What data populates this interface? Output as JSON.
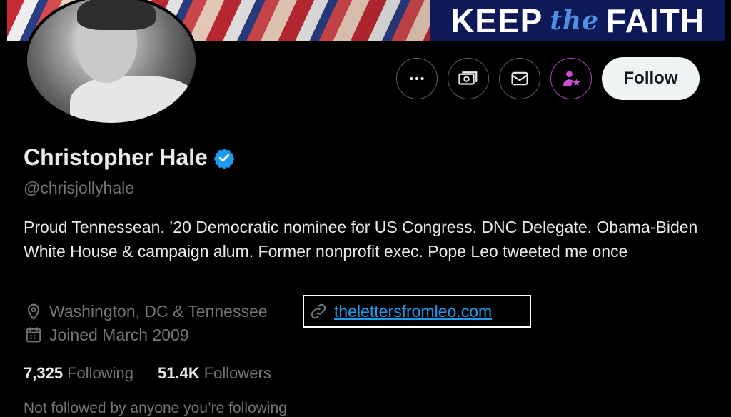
{
  "banner": {
    "sign_left": "KEEP",
    "sign_mid": "the",
    "sign_right": "FAITH"
  },
  "actions": {
    "more_icon": "more-horizontal-icon",
    "tips_icon": "money-icon",
    "message_icon": "envelope-icon",
    "subscribe_icon": "subscribe-person-star-icon",
    "follow_label": "Follow"
  },
  "profile": {
    "name": "Christopher Hale",
    "handle": "@chrisjollyhale",
    "bio": "Proud Tennessean. ’20 Democratic nominee for US Congress. DNC Delegate. Obama-Biden White House & campaign alum. Former nonprofit exec. Pope Leo tweeted me once",
    "location": "Washington, DC & Tennessee",
    "website": "thelettersfromleo.com",
    "joined": "Joined March 2009"
  },
  "stats": {
    "following_count": "7,325",
    "following_label": "Following",
    "followers_count": "51.4K",
    "followers_label": "Followers"
  },
  "footer": {
    "not_followed": "Not followed by anyone you’re following"
  },
  "colors": {
    "accent_blue": "#1d9bf0",
    "subscribe_purple": "#b544c7",
    "muted_text": "#71767b"
  }
}
